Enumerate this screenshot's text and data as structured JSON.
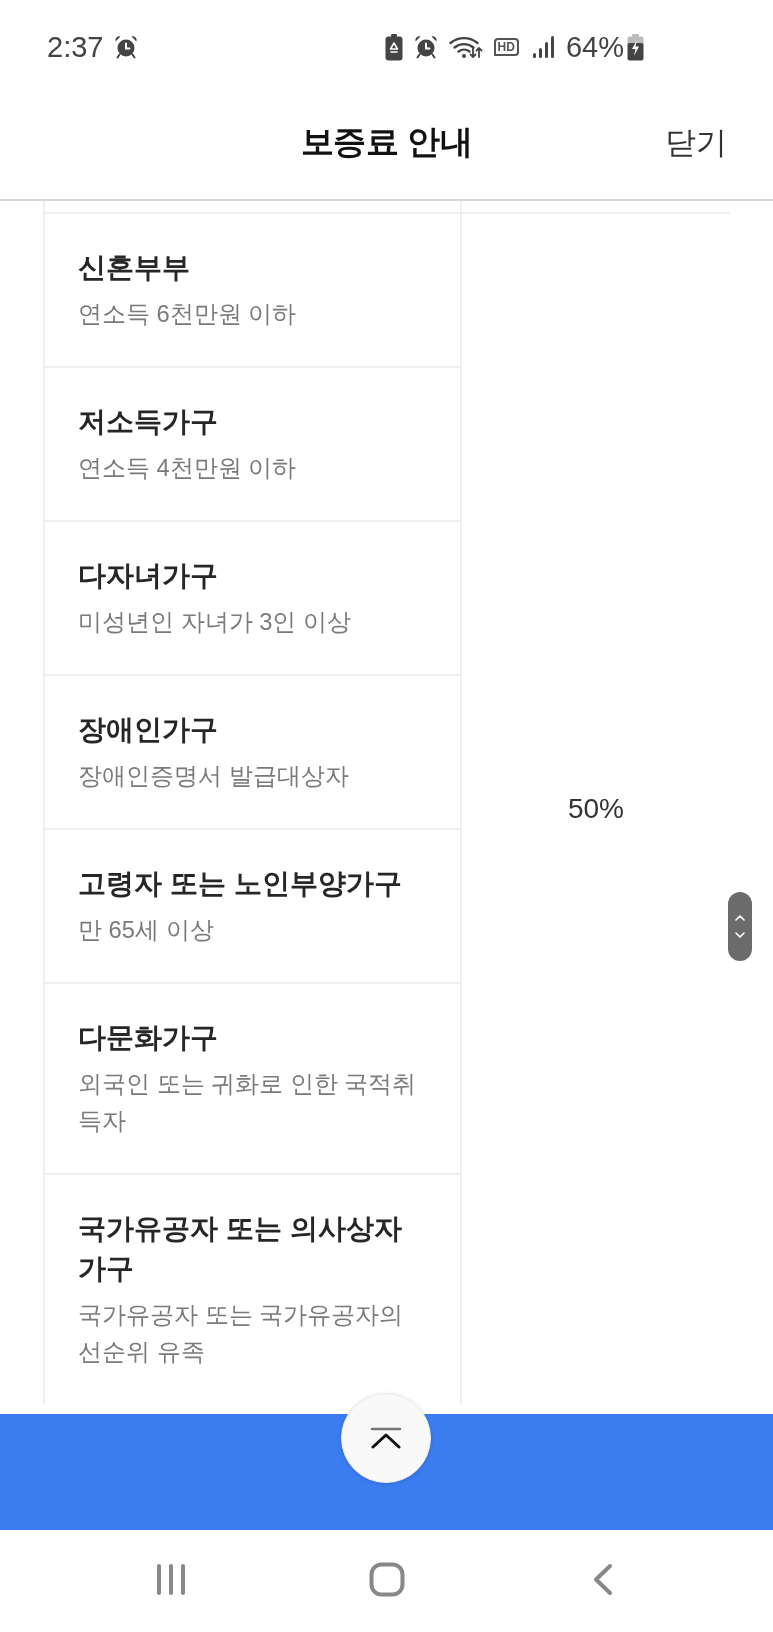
{
  "status_bar": {
    "time": "2:37",
    "network_badge": "HD",
    "battery": "64%"
  },
  "header": {
    "title": "보증료 안내",
    "close": "닫기"
  },
  "table": {
    "rows": [
      {
        "title": "신혼부부",
        "subtitle": "연소득 6천만원 이하"
      },
      {
        "title": "저소득가구",
        "subtitle": "연소득 4천만원 이하"
      },
      {
        "title": "다자녀가구",
        "subtitle": "미성년인 자녀가 3인 이상"
      },
      {
        "title": "장애인가구",
        "subtitle": "장애인증명서 발급대상자"
      },
      {
        "title": "고령자 또는 노인부양가구",
        "subtitle": "만 65세 이상"
      },
      {
        "title": "다문화가구",
        "subtitle": "외국인 또는 귀화로 인한 국적취득자"
      },
      {
        "title": "국가유공자 또는 의사상자 가구",
        "subtitle": "국가유공자 또는 국가유공자의 선순위 유족"
      }
    ],
    "rate": "50%"
  }
}
